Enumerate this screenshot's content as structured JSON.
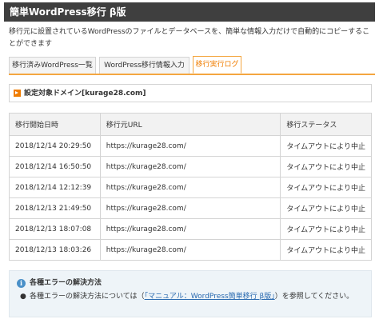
{
  "page": {
    "title": "簡単WordPress移行 β版",
    "intro": "移行元に設置されているWordPressのファイルとデータベースを、簡単な情報入力だけで自動的にコピーすることができます"
  },
  "tabs": [
    {
      "label": "移行済みWordPress一覧",
      "active": false
    },
    {
      "label": "WordPress移行情報入力",
      "active": false
    },
    {
      "label": "移行実行ログ",
      "active": true
    }
  ],
  "domain": {
    "label": "設定対象ドメイン[kurage28.com]"
  },
  "log_table": {
    "headers": [
      "移行開始日時",
      "移行元URL",
      "移行ステータス"
    ],
    "rows": [
      {
        "date": "2018/12/14 20:29:50",
        "url": "https://kurage28.com/",
        "status": "タイムアウトにより中止"
      },
      {
        "date": "2018/12/14 16:50:50",
        "url": "https://kurage28.com/",
        "status": "タイムアウトにより中止"
      },
      {
        "date": "2018/12/14 12:12:39",
        "url": "https://kurage28.com/",
        "status": "タイムアウトにより中止"
      },
      {
        "date": "2018/12/13 21:49:50",
        "url": "https://kurage28.com/",
        "status": "タイムアウトにより中止"
      },
      {
        "date": "2018/12/13 18:07:08",
        "url": "https://kurage28.com/",
        "status": "タイムアウトにより中止"
      },
      {
        "date": "2018/12/13 18:03:26",
        "url": "https://kurage28.com/",
        "status": "タイムアウトにより中止"
      }
    ]
  },
  "help": {
    "icon": "info-icon",
    "icon_glyph": "i",
    "title": "各種エラーの解決方法",
    "text_before": "各種エラーの解決方法については（",
    "link_text": "「マニュアル：WordPress簡単移行 β版」",
    "text_after": "）を参照してください。"
  },
  "colors": {
    "title_bar": "#3f3f3f",
    "accent": "#f07d00",
    "status_error": "#e8161b",
    "link": "#2a6ab0"
  }
}
